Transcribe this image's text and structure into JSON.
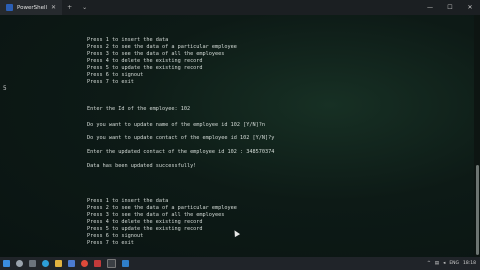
{
  "titlebar": {
    "tab_title": "PowerShell",
    "tab_close": "✕",
    "new_tab": "+",
    "dropdown": "⌄",
    "minimize": "—",
    "maximize": "☐",
    "close": "✕"
  },
  "console": {
    "marker": "5",
    "lines": [
      "Press 1 to insert the data",
      "Press 2 to see the data of a particular employee",
      "Press 3 to see the data of all the employees",
      "Press 4 to delete the existing record",
      "Press 5 to update the existing record",
      "Press 6 to signout",
      "Press 7 to exit",
      "Enter the Id of the employee: 102",
      "Do you want to update name of the employee id 102 [Y/N]?n",
      "Do you want to update contact of the employee id 102 [Y/N]?y",
      "Enter the updated contact of the employee id 102 : 348570374",
      "Data has been updated successfully!",
      "Press 1 to insert the data",
      "Press 2 to see the data of a particular employee",
      "Press 3 to see the data of all the employees",
      "Press 4 to delete the existing record",
      "Press 5 to update the existing record",
      "Press 6 to signout",
      "Press 7 to exit"
    ]
  },
  "taskbar": {
    "lang": "ENG",
    "time": "18:18"
  },
  "colors": {
    "console_bg": "#0c1714",
    "text": "#d5dcd8",
    "titlebar": "#1b1f22",
    "taskbar": "#202429"
  },
  "icons": [
    "start-icon",
    "search-icon",
    "task-view-icon",
    "edge-icon",
    "explorer-icon",
    "store-icon",
    "chrome-icon",
    "app-icon",
    "terminal-icon",
    "vscode-icon"
  ]
}
